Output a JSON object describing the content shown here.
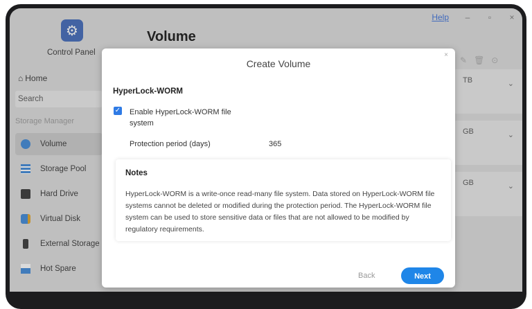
{
  "window": {
    "help_label": "Help",
    "minimize": "–",
    "maximize": "▫",
    "close": "×"
  },
  "sidebar": {
    "app_label": "Control Panel",
    "home_label": "Home",
    "search_placeholder": "Search",
    "section_label": "Storage Manager",
    "items": [
      {
        "label": "Volume",
        "icon": "volume-icon",
        "active": true
      },
      {
        "label": "Storage Pool",
        "icon": "storage-pool-icon"
      },
      {
        "label": "Hard Drive",
        "icon": "hard-drive-icon"
      },
      {
        "label": "Virtual Disk",
        "icon": "virtual-disk-icon"
      },
      {
        "label": "External Storage",
        "icon": "external-storage-icon"
      },
      {
        "label": "Hot Spare",
        "icon": "hot-spare-icon"
      }
    ]
  },
  "main": {
    "title": "Volume",
    "cards": [
      {
        "value": "TB"
      },
      {
        "value": "GB"
      },
      {
        "value": "GB"
      }
    ]
  },
  "modal": {
    "title": "Create Volume",
    "close": "×",
    "section": "HyperLock-WORM",
    "enable_label": "Enable HyperLock-WORM file system",
    "enable_checked": true,
    "period_label": "Protection period (days)",
    "period_value": "365",
    "notes_title": "Notes",
    "notes_text": "HyperLock-WORM is a write-once read-many file system. Data stored on HyperLock-WORM file systems cannot be deleted or modified during the protection period. The HyperLock-WORM file system can be used to store sensitive data or files that are not allowed to be modified by regulatory requirements.",
    "back_label": "Back",
    "next_label": "Next"
  },
  "colors": {
    "accent": "#1f86e8",
    "sidebar_active": "#c9c9c9",
    "checkbox": "#2f7be5"
  }
}
